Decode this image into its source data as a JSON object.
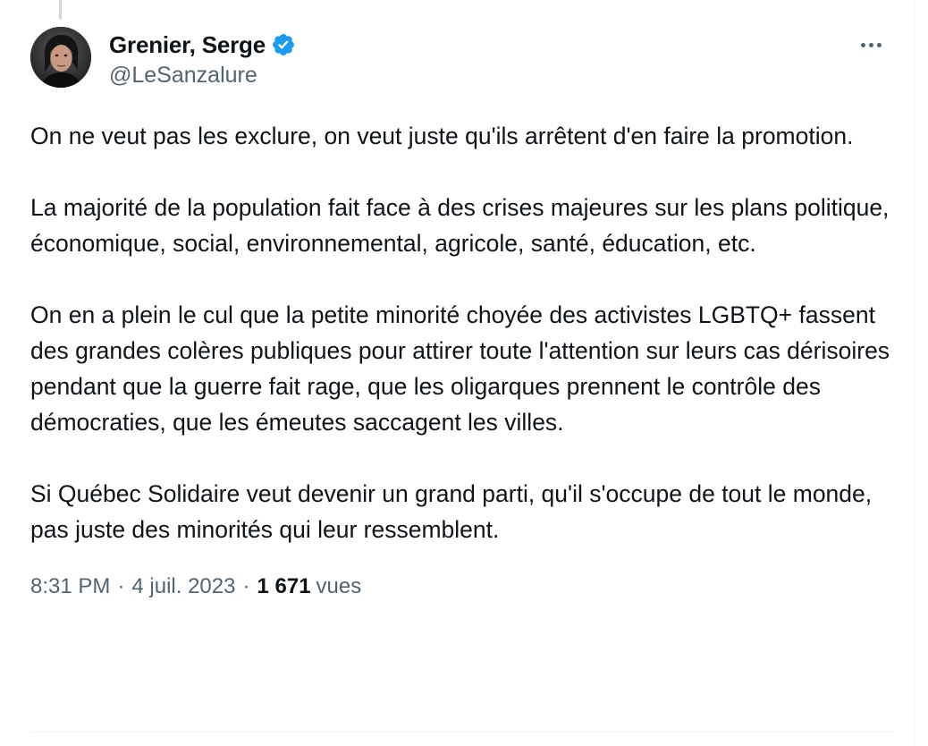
{
  "author": {
    "display_name": "Grenier, Serge",
    "handle": "@LeSanzalure",
    "verified": true,
    "avatar_icon": "profile-photo",
    "verified_icon": "verified-badge-icon",
    "verified_color": "#1d9bf0"
  },
  "menu": {
    "more_icon": "more-horizontal-icon"
  },
  "tweet": {
    "paragraphs": [
      "On ne veut pas les exclure, on veut juste qu'ils arrêtent d'en faire la promotion.",
      "La majorité de la population fait face à des crises majeures sur les plans politique, économique, social, environnemental, agricole, santé, éducation, etc.",
      "On en a plein le cul que la petite minorité choyée des activistes LGBTQ+ fassent des grandes colères publiques pour attirer toute l'attention sur leurs cas dérisoires pendant que la guerre fait rage, que les oligarques prennent le contrôle des démocraties, que les émeutes saccagent les villes.",
      "Si Québec Solidaire veut devenir un grand parti, qu'il s'occupe de tout le monde, pas juste des minorités qui leur ressemblent."
    ]
  },
  "meta": {
    "time": "8:31 PM",
    "separator": "·",
    "date": "4 juil. 2023",
    "views_count": "1 671",
    "views_label": "vues"
  },
  "colors": {
    "text_primary": "#0f1419",
    "text_secondary": "#536471",
    "border": "#eff3f4"
  }
}
